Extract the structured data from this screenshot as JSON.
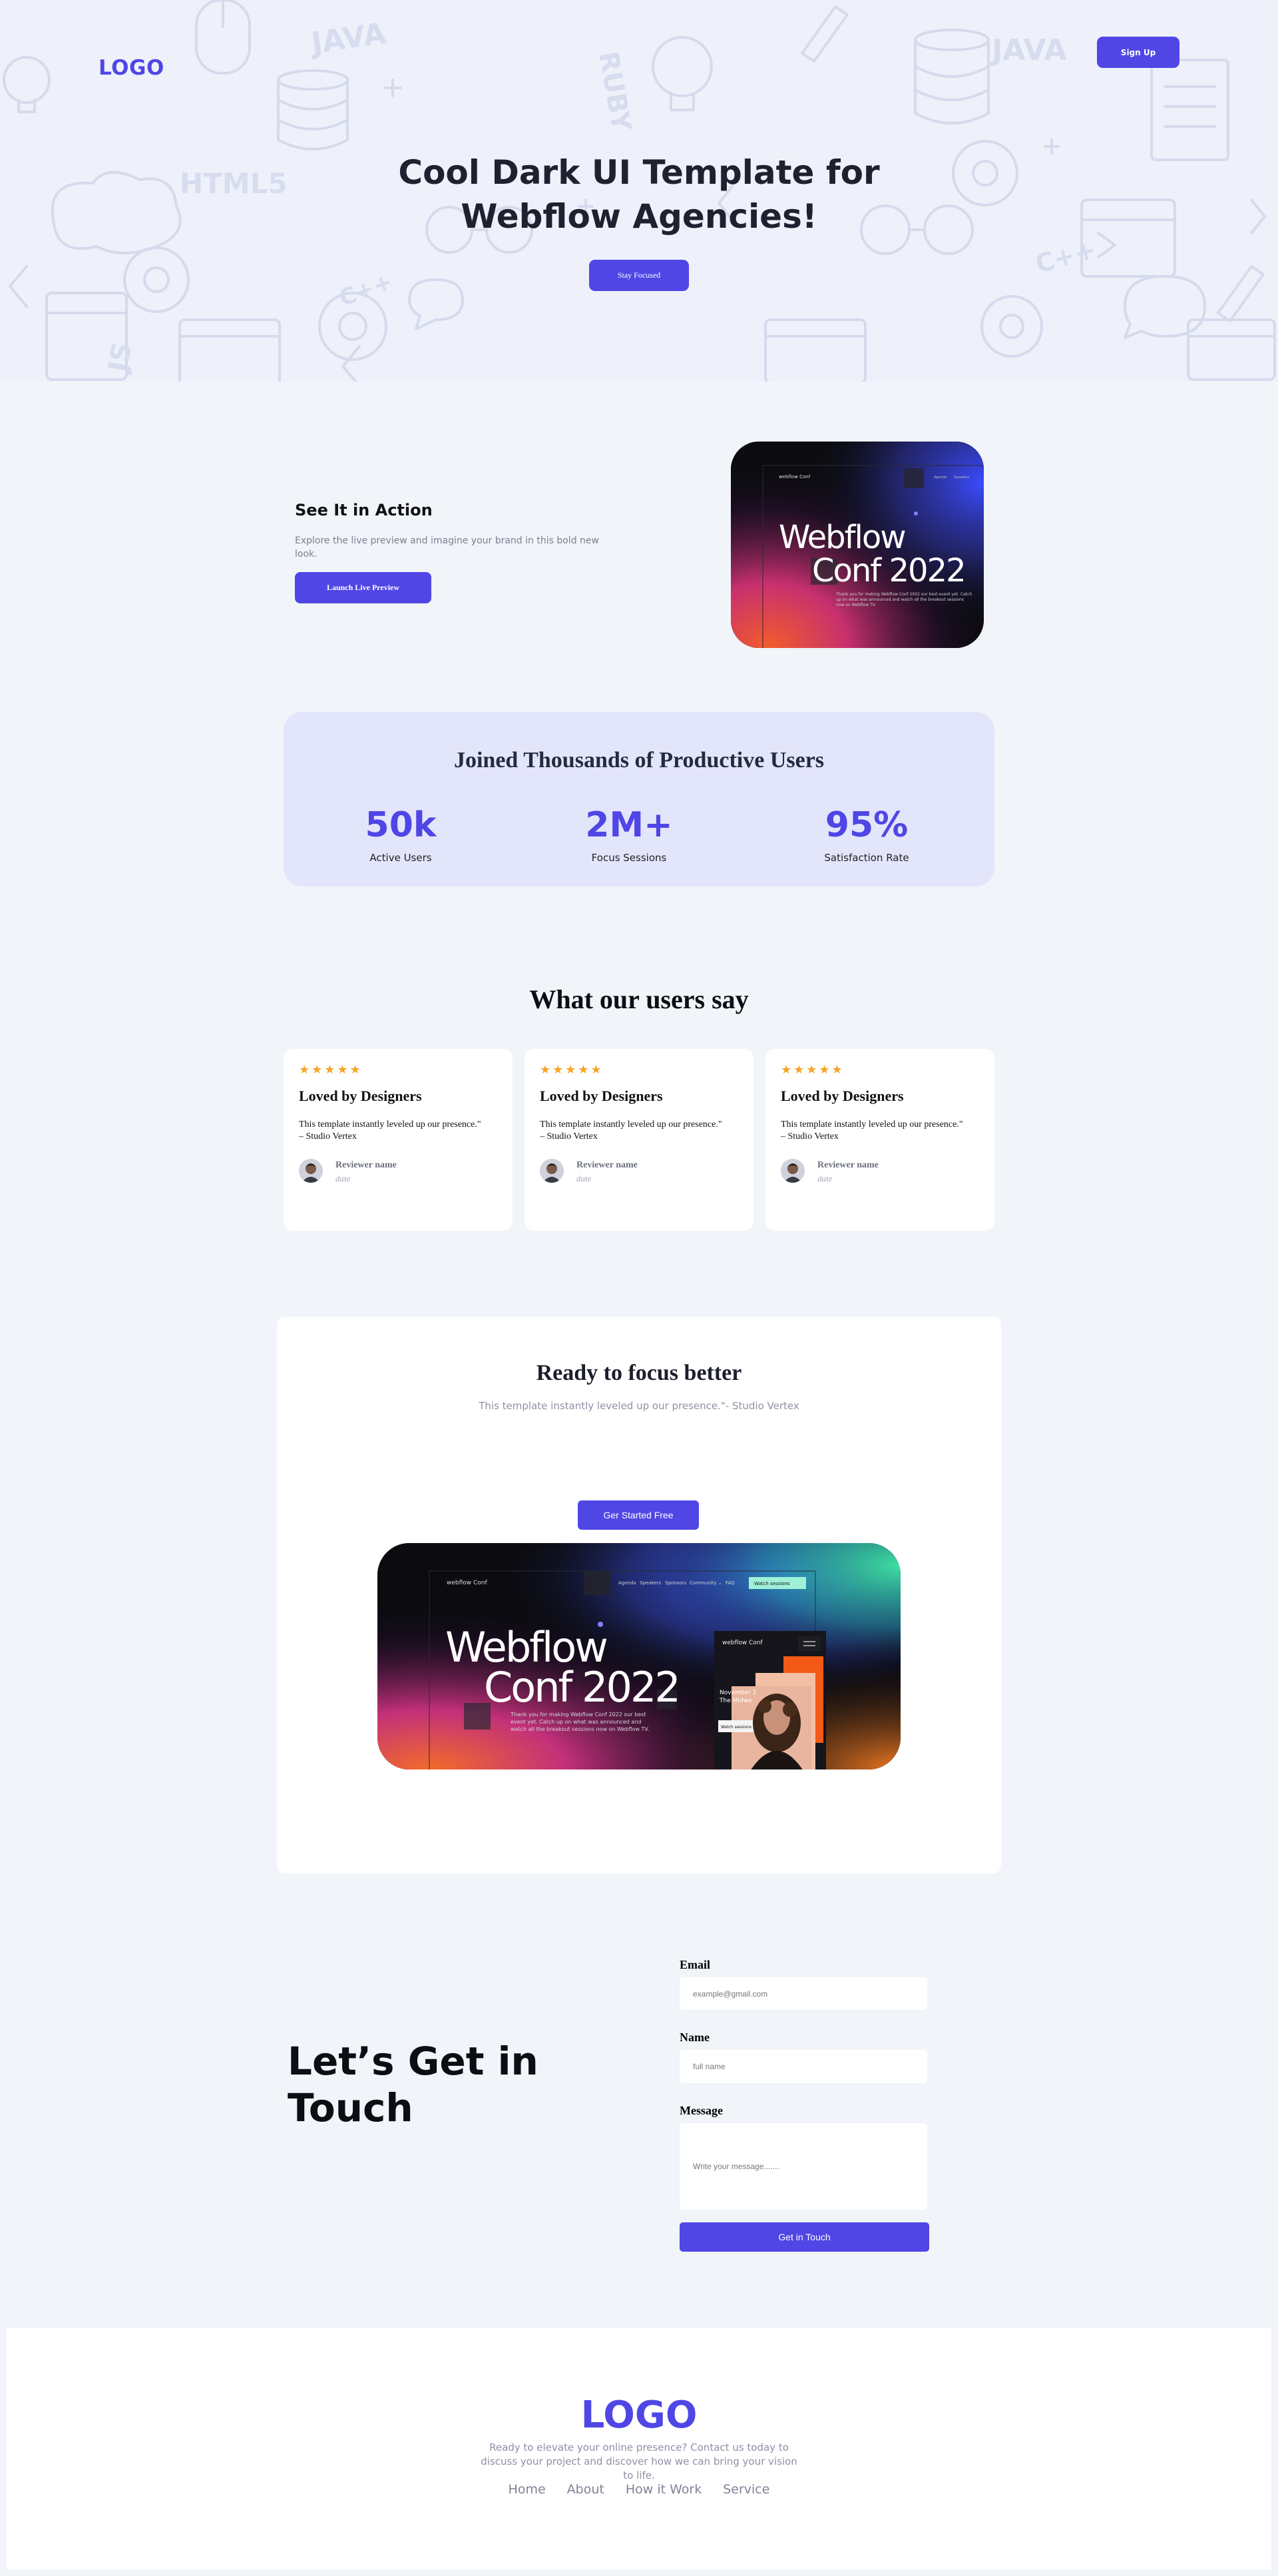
{
  "header": {
    "logo": "LOGO",
    "signup_label": "Sign Up"
  },
  "hero": {
    "title_line1": "Cool Dark UI Template for",
    "title_line2": "Webflow Agencies!",
    "cta_label": "Stay Focused",
    "doodle_labels": [
      "JAVA",
      "RUBY",
      "HTML5",
      "C++",
      "JS",
      "JAVA",
      "C++"
    ]
  },
  "action": {
    "title": "See It in Action",
    "description": "Explore the live preview and imagine your brand in this bold new look.",
    "button_label": "Launch Live Preview"
  },
  "preview_small": {
    "brand": "webflow Conf",
    "headline_line1": "Webflow",
    "headline_line2": "Conf 2022",
    "blurb": "Thank you for making Webflow Conf 2022 our best event yet. Catch up on what was announced and watch all the breakout sessions now on Webflow TV.",
    "nav": [
      "Agenda",
      "Speakers"
    ]
  },
  "stats": {
    "title": "Joined Thousands of Productive Users",
    "items": [
      {
        "value": "50k",
        "label": "Active Users"
      },
      {
        "value": "2M+",
        "label": "Focus Sessions"
      },
      {
        "value": "95%",
        "label": "Satisfaction Rate"
      }
    ]
  },
  "testimonials": {
    "title": "What our users say",
    "rating": 5,
    "items": [
      {
        "stars": "★★★★★",
        "title": "Loved by Designers",
        "quote_line1": "This template instantly leveled up our presence.\"",
        "quote_line2": "– Studio Vertex",
        "name": "Reviewer name",
        "date": "date"
      },
      {
        "stars": "★★★★★",
        "title": "Loved by Designers",
        "quote_line1": "This template instantly leveled up our presence.\"",
        "quote_line2": "– Studio Vertex",
        "name": "Reviewer name",
        "date": "date"
      },
      {
        "stars": "★★★★★",
        "title": "Loved by Designers",
        "quote_line1": "This template instantly leveled up our presence.\"",
        "quote_line2": "– Studio Vertex",
        "name": "Reviewer name",
        "date": "date"
      }
    ]
  },
  "ready": {
    "title": "Ready to focus better",
    "subtitle": "This template instantly leveled up our presence.\"- Studio Vertex",
    "button_label": "Ger Started Free"
  },
  "preview_big": {
    "brand": "webflow Conf",
    "headline_line1": "Webflow",
    "headline_line2": "Conf 2022",
    "blurb": "Thank you for making Webflow Conf 2022 our best event yet. Catch up on what was announced and watch all the breakout sessions now on Webflow TV.",
    "nav": [
      "Agenda",
      "Speakers",
      "Sponsors",
      "Community ⌄",
      "FAQ"
    ],
    "watch_label": "Watch sessions",
    "mobile_brand": "webflow Conf",
    "mobile_date": "November 1",
    "mobile_place": "The Midwe",
    "mobile_btn": "Watch sessions"
  },
  "contact": {
    "title_line1": "Let’s Get in",
    "title_line2": "Touch",
    "email_label": "Email",
    "email_placeholder": "example@gmail.com",
    "name_label": "Name",
    "name_placeholder": "full name",
    "message_label": "Message",
    "message_placeholder": "Write your message.......",
    "submit_label": "Get in Touch"
  },
  "footer": {
    "logo": "LOGO",
    "description": "Ready to elevate your online presence? Contact us today to discuss your project and discover how we can bring your vision to life.",
    "nav": [
      "Home",
      "About",
      "How it Work",
      "Service"
    ]
  },
  "colors": {
    "accent": "#4f46e5",
    "page_bg": "#f1f4f9",
    "stats_bg": "#e3e5fb",
    "star": "#f5a524"
  }
}
